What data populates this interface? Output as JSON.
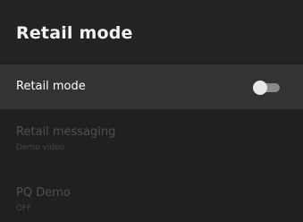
{
  "header": {
    "title": "Retail mode"
  },
  "items": [
    {
      "label": "Retail mode",
      "toggle": {
        "state": "off"
      }
    },
    {
      "label": "Retail messaging",
      "sublabel": "Demo video"
    },
    {
      "label": "PQ Demo",
      "sublabel": "OFF"
    }
  ],
  "colors": {
    "background": "#202020",
    "focused_row": "#333333",
    "disabled_text": "#4f4f4f"
  }
}
